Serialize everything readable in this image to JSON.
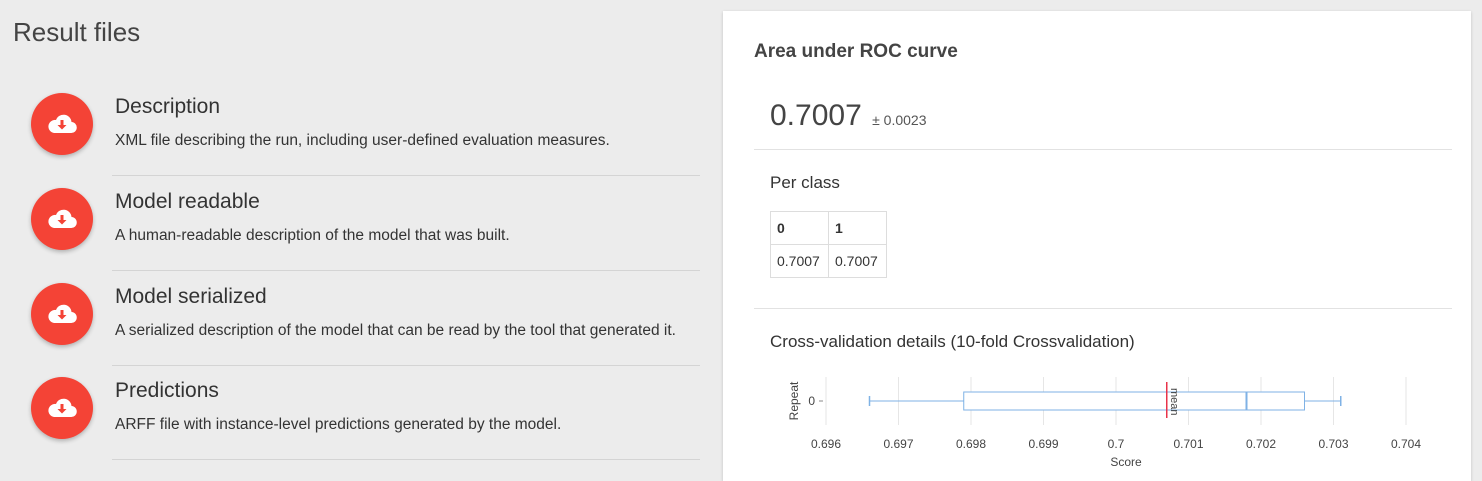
{
  "left": {
    "title": "Result files",
    "files": [
      {
        "name": "Description",
        "description": "XML file describing the run, including user-defined evaluation measures.",
        "icon": "cloud-download-icon"
      },
      {
        "name": "Model readable",
        "description": "A human-readable description of the model that was built.",
        "icon": "cloud-download-icon"
      },
      {
        "name": "Model serialized",
        "description": "A serialized description of the model that can be read by the tool that generated it.",
        "icon": "cloud-download-icon"
      },
      {
        "name": "Predictions",
        "description": "ARFF file with instance-level predictions generated by the model.",
        "icon": "cloud-download-icon"
      }
    ],
    "accent": "#f44336"
  },
  "card": {
    "title": "Area under ROC curve",
    "value": "0.7007",
    "error": "± 0.0023",
    "per_class_label": "Per class",
    "per_class": {
      "headers": [
        "0",
        "1"
      ],
      "values": [
        "0.7007",
        "0.7007"
      ]
    },
    "cv_label": "Cross-validation details (10-fold Crossvalidation)"
  },
  "chart_data": {
    "type": "box",
    "ylabel": "Repeat",
    "xlabel": "Score",
    "categories": [
      "0"
    ],
    "xticks": [
      "0.696",
      "0.697",
      "0.698",
      "0.699",
      "0.7",
      "0.701",
      "0.702",
      "0.703",
      "0.704"
    ],
    "xlim": [
      0.696,
      0.704
    ],
    "box": {
      "min": 0.6966,
      "q1": 0.6979,
      "median": 0.7018,
      "q3": 0.7026,
      "max": 0.7031
    },
    "mean": 0.7007,
    "mean_label": "mean",
    "box_color": "#7fb2e5",
    "mean_color": "#e8334a"
  }
}
